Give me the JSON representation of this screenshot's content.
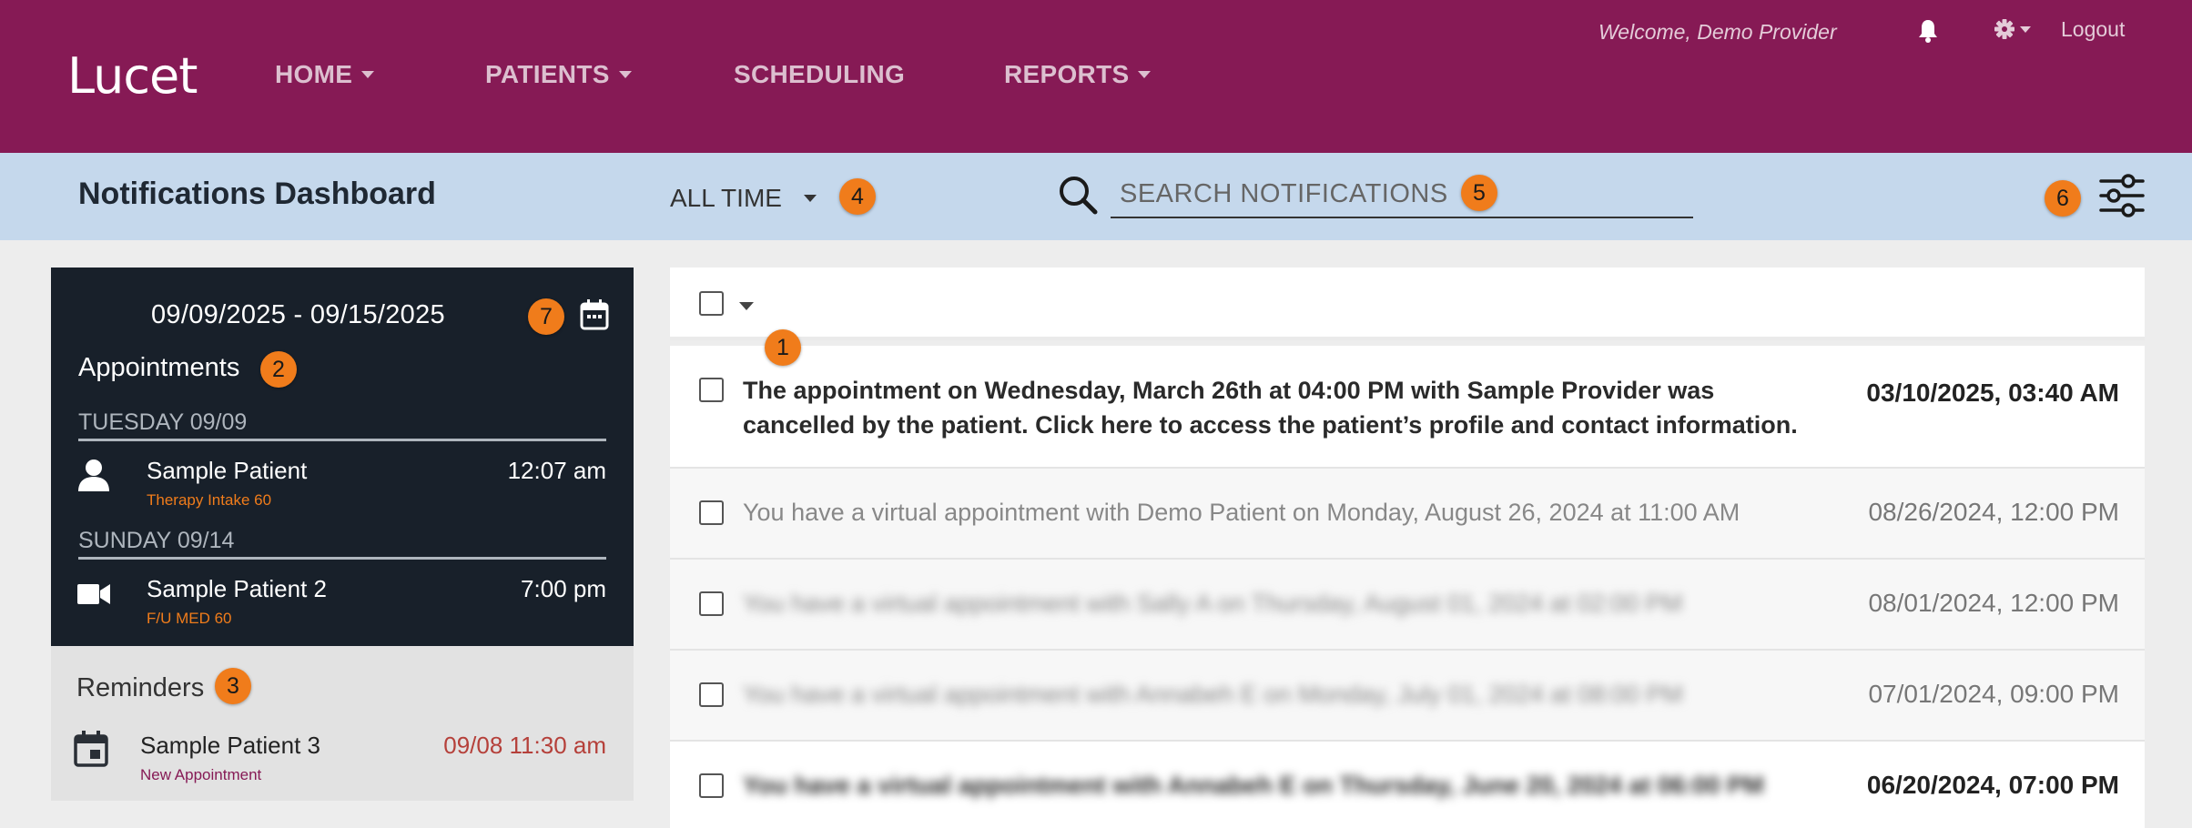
{
  "app": {
    "logo": "Lucet",
    "welcome": "Welcome, Demo Provider",
    "logout_label": "Logout"
  },
  "nav": {
    "home": "HOME",
    "patients": "PATIENTS",
    "scheduling": "SCHEDULING",
    "reports": "REPORTS"
  },
  "toolbar": {
    "title": "Notifications Dashboard",
    "time_filter": "ALL TIME",
    "search_placeholder": "SEARCH NOTIFICATIONS"
  },
  "appointments": {
    "date_range": "09/09/2025 - 09/15/2025",
    "title": "Appointments",
    "days": [
      {
        "label": "TUESDAY 09/09",
        "items": [
          {
            "name": "Sample Patient",
            "type": "Therapy Intake 60",
            "time": "12:07 am",
            "icon": "person-icon"
          }
        ]
      },
      {
        "label": "SUNDAY 09/14",
        "items": [
          {
            "name": "Sample Patient 2",
            "type": "F/U MED 60",
            "time": "7:00 pm",
            "icon": "video-camera-icon"
          }
        ]
      }
    ]
  },
  "reminders": {
    "title": "Reminders",
    "items": [
      {
        "name": "Sample Patient 3",
        "type": "New Appointment",
        "time": "09/08 11:30 am",
        "icon": "calendar-event-icon"
      }
    ]
  },
  "notifications": [
    {
      "line1": "The appointment on Wednesday, March 26th at 04:00 PM with Sample Provider was",
      "line2": "cancelled by the patient. Click here to access the patient’s profile and contact information.",
      "date": "03/10/2025, 03:40 AM",
      "state": "unread"
    },
    {
      "line1": "You have a virtual appointment with Demo Patient on Monday, August 26, 2024 at 11:00 AM",
      "date": "08/26/2024, 12:00 PM",
      "state": "read"
    },
    {
      "line1": "You have a virtual appointment with Sally A on Thursday, August 01, 2024 at 02:00 PM",
      "date": "08/01/2024, 12:00 PM",
      "state": "read",
      "blurred": true
    },
    {
      "line1": "You have a virtual appointment with Annabeh E on Monday, July 01, 2024 at 08:00 PM",
      "date": "07/01/2024, 09:00 PM",
      "state": "read",
      "blurred": true
    },
    {
      "line1": "You have a virtual appointment with Annabeh E on Thursday, June 20, 2024 at 06:00 PM",
      "date": "06/20/2024, 07:00 PM",
      "state": "unread",
      "blurred": true
    }
  ],
  "callouts": [
    "1",
    "2",
    "3",
    "4",
    "5",
    "6",
    "7"
  ],
  "colors": {
    "brand": "#861a55",
    "subbar": "#c5d8ec",
    "panel_dark": "#18202a",
    "callout": "#f07c1b",
    "reminder_time": "#b5403a"
  }
}
